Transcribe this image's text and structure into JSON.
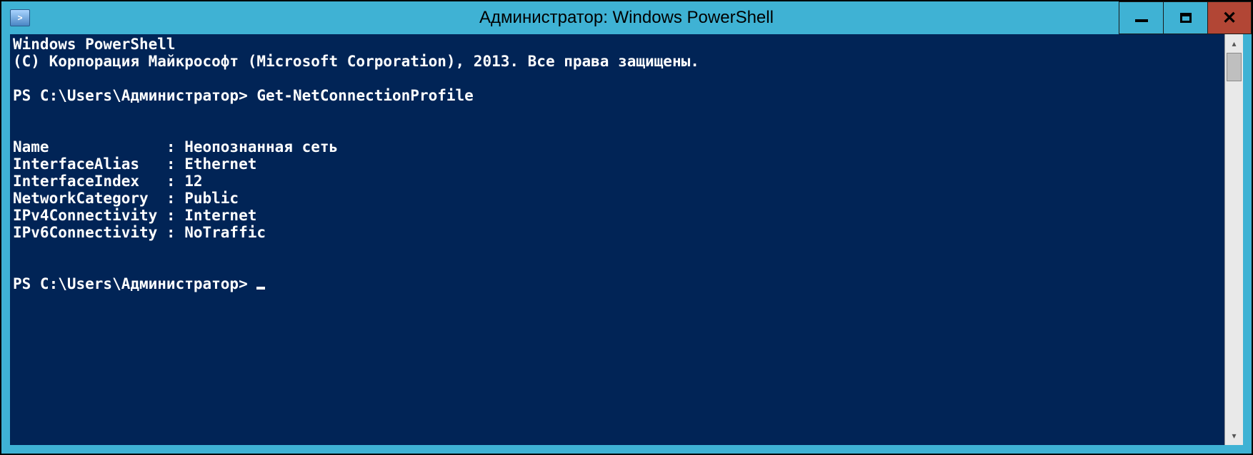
{
  "window": {
    "title": "Администратор: Windows PowerShell"
  },
  "console": {
    "banner_line1": "Windows PowerShell",
    "banner_line2": "(C) Корпорация Майкрософт (Microsoft Corporation), 2013. Все права защищены.",
    "prompt1_prefix": "PS C:\\Users\\Администратор> ",
    "command1": "Get-NetConnectionProfile",
    "output": {
      "Name": "Неопознанная сеть",
      "InterfaceAlias": "Ethernet",
      "InterfaceIndex": "12",
      "NetworkCategory": "Public",
      "IPv4Connectivity": "Internet",
      "IPv6Connectivity": "NoTraffic"
    },
    "out_line1": "Name             : Неопознанная сеть",
    "out_line2": "InterfaceAlias   : Ethernet",
    "out_line3": "InterfaceIndex   : 12",
    "out_line4": "NetworkCategory  : Public",
    "out_line5": "IPv4Connectivity : Internet",
    "out_line6": "IPv6Connectivity : NoTraffic",
    "prompt2_prefix": "PS C:\\Users\\Администратор> "
  }
}
